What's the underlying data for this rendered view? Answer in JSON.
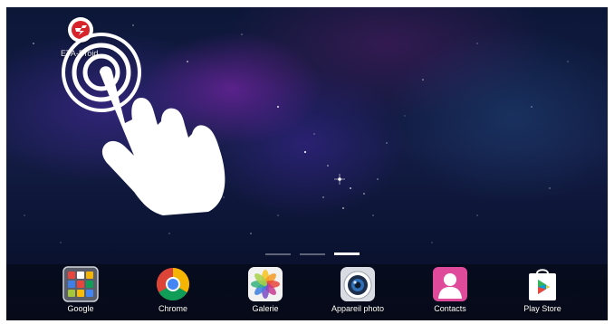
{
  "home_screen": {
    "shortcut": {
      "label": "ETA-Droid",
      "icon": "eta-droid-logo-icon"
    },
    "gesture_overlay": {
      "icon": "tap-hand-icon"
    },
    "pages": {
      "count": 3,
      "current": 3
    }
  },
  "dock": {
    "items": [
      {
        "label": "Google",
        "icon": "google-folder-icon"
      },
      {
        "label": "Chrome",
        "icon": "chrome-icon"
      },
      {
        "label": "Galerie",
        "icon": "gallery-icon"
      },
      {
        "label": "Appareil photo",
        "icon": "camera-icon"
      },
      {
        "label": "Contacts",
        "icon": "contacts-icon"
      },
      {
        "label": "Play Store",
        "icon": "play-store-icon"
      }
    ]
  },
  "colors": {
    "wallpaper_dark": "#0c1738",
    "nebula_purple": "#9628c8",
    "eta_red": "#d6242a",
    "contacts_pink": "#e04a9a"
  }
}
